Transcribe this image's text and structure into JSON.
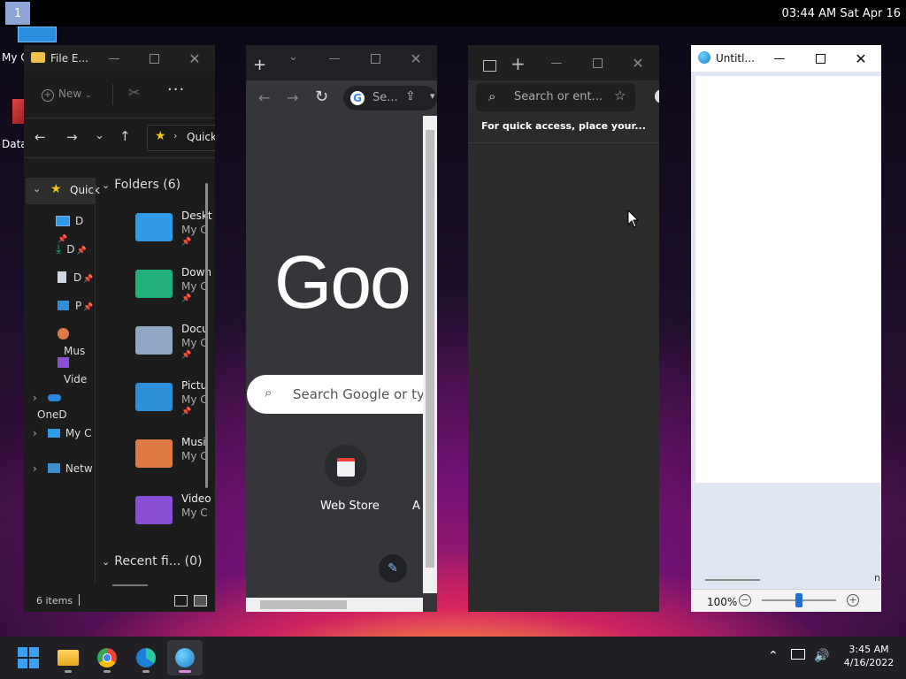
{
  "topbar": {
    "workspace": "1",
    "clock": "03:44 AM  Sat Apr 16"
  },
  "desktop": {
    "icon1_label": "My C",
    "icon2_label": "Data"
  },
  "explorer": {
    "title": "File E...",
    "new_label": "New",
    "path": "Quick",
    "nav": [
      {
        "label": "Quick",
        "icon": "star-icon"
      },
      {
        "label": "D",
        "icon": "desktop-icon"
      },
      {
        "label": "D",
        "icon": "download-icon"
      },
      {
        "label": "D",
        "icon": "document-icon"
      },
      {
        "label": "P",
        "icon": "pictures-icon"
      },
      {
        "label": "Mus",
        "icon": "music-icon"
      },
      {
        "label": "Vide",
        "icon": "video-icon"
      },
      {
        "label": "OneD",
        "icon": "cloud-icon"
      },
      {
        "label": "My C",
        "icon": "computer-icon"
      },
      {
        "label": "Netw",
        "icon": "network-icon"
      }
    ],
    "folders_header": "Folders (6)",
    "folders": [
      {
        "name": "Deskt",
        "sub": "My C",
        "color": "#2f9be6"
      },
      {
        "name": "Down",
        "sub": "My C",
        "color": "#22b07a"
      },
      {
        "name": "Docu",
        "sub": "My C",
        "color": "#8fa6c4"
      },
      {
        "name": "Pictu",
        "sub": "My C",
        "color": "#2d8fd8"
      },
      {
        "name": "Musi",
        "sub": "My C",
        "color": "#e07a45"
      },
      {
        "name": "Video",
        "sub": "My C",
        "color": "#8a4fd6"
      }
    ],
    "recent_header": "Recent fi... (0)",
    "status": "6 items"
  },
  "chrome": {
    "search_short": "Se...",
    "logo": "Goo",
    "search_placeholder": "Search Google or typ",
    "shortcut1": "Web Store",
    "shortcut2": "A"
  },
  "edge": {
    "address_placeholder": "Search or ent...",
    "quick_access": "For quick access, place your..."
  },
  "paint": {
    "title": "Untitl...",
    "zoom": "100%",
    "edge_text": "n"
  },
  "taskbar": {
    "time": "3:45 AM",
    "date": "4/16/2022"
  }
}
